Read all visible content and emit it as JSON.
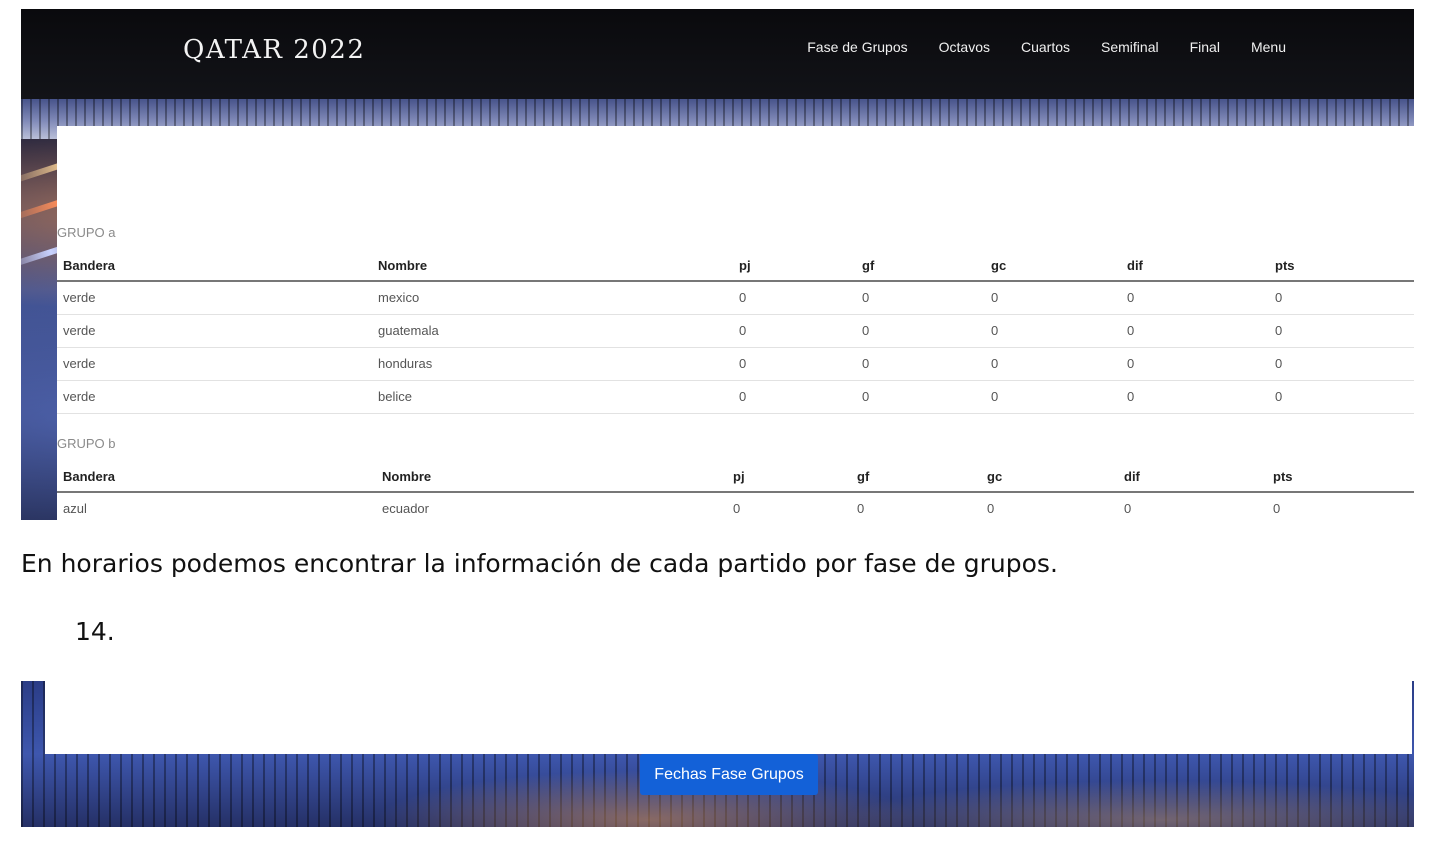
{
  "site": {
    "brand": "QATAR 2022",
    "nav": [
      "Fase de Grupos",
      "Octavos",
      "Cuartos",
      "Semifinal",
      "Final",
      "Menu"
    ]
  },
  "groups": [
    {
      "label": "GRUPO a",
      "headers": [
        "Bandera",
        "Nombre",
        "pj",
        "gf",
        "gc",
        "dif",
        "pts"
      ],
      "rows": [
        [
          "verde",
          "mexico",
          "0",
          "0",
          "0",
          "0",
          "0"
        ],
        [
          "verde",
          "guatemala",
          "0",
          "0",
          "0",
          "0",
          "0"
        ],
        [
          "verde",
          "honduras",
          "0",
          "0",
          "0",
          "0",
          "0"
        ],
        [
          "verde",
          "belice",
          "0",
          "0",
          "0",
          "0",
          "0"
        ]
      ]
    },
    {
      "label": "GRUPO b",
      "headers": [
        "Bandera",
        "Nombre",
        "pj",
        "gf",
        "gc",
        "dif",
        "pts"
      ],
      "rows": [
        [
          "azul",
          "ecuador",
          "0",
          "0",
          "0",
          "0",
          "0"
        ]
      ]
    }
  ],
  "document": {
    "caption": "En horarios podemos encontrar la información de cada partido por fase de grupos.",
    "step_number": "14."
  },
  "schedule": {
    "button_label": "Fechas Fase Grupos"
  },
  "colors": {
    "nav_background": "#0a0a0d",
    "button_primary": "#1361d8"
  }
}
